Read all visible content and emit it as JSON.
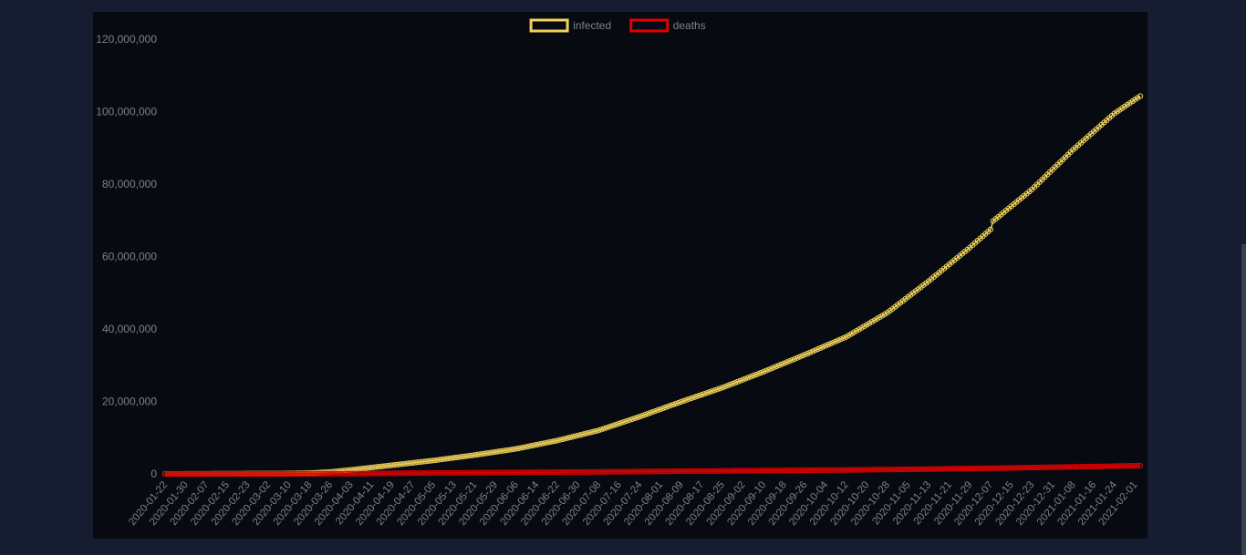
{
  "colors": {
    "page_bg": "#161d30",
    "panel_bg": "#070b11",
    "infected": "#f0d25a",
    "deaths": "#e00000",
    "tick": "#7d8088"
  },
  "legend": [
    {
      "label": "infected",
      "color": "#f0d25a"
    },
    {
      "label": "deaths",
      "color": "#e00000"
    }
  ],
  "chart_data": {
    "type": "line",
    "x_start": "2020-01-22",
    "x_end": "2021-02-03",
    "x_tick_labels": [
      "2020-01-22",
      "2020-01-30",
      "2020-02-07",
      "2020-02-15",
      "2020-02-23",
      "2020-03-02",
      "2020-03-10",
      "2020-03-18",
      "2020-03-26",
      "2020-04-03",
      "2020-04-11",
      "2020-04-19",
      "2020-04-27",
      "2020-05-05",
      "2020-05-13",
      "2020-05-21",
      "2020-05-29",
      "2020-06-06",
      "2020-06-14",
      "2020-06-22",
      "2020-06-30",
      "2020-07-08",
      "2020-07-16",
      "2020-07-24",
      "2020-08-01",
      "2020-08-09",
      "2020-08-17",
      "2020-08-25",
      "2020-09-02",
      "2020-09-10",
      "2020-09-18",
      "2020-09-26",
      "2020-10-04",
      "2020-10-12",
      "2020-10-20",
      "2020-10-28",
      "2020-11-05",
      "2020-11-13",
      "2020-11-21",
      "2020-11-29",
      "2020-12-07",
      "2020-12-15",
      "2020-12-23",
      "2020-12-31",
      "2021-01-08",
      "2021-01-16",
      "2021-01-24",
      "2021-02-01"
    ],
    "ylim": [
      0,
      120000000
    ],
    "y_tick_labels": [
      "0",
      "20,000,000",
      "40,000,000",
      "60,000,000",
      "80,000,000",
      "100,000,000",
      "120,000,000"
    ],
    "grid": false,
    "legend_position": "top",
    "series": [
      {
        "name": "infected",
        "color": "#f0d25a",
        "points": [
          [
            "2020-01-22",
            555
          ],
          [
            "2020-02-15",
            69000
          ],
          [
            "2020-03-10",
            120000
          ],
          [
            "2020-03-18",
            215000
          ],
          [
            "2020-03-26",
            530000
          ],
          [
            "2020-04-03",
            1100000
          ],
          [
            "2020-04-19",
            2400000
          ],
          [
            "2020-05-05",
            3700000
          ],
          [
            "2020-05-21",
            5200000
          ],
          [
            "2020-06-06",
            6900000
          ],
          [
            "2020-06-22",
            9200000
          ],
          [
            "2020-07-08",
            12000000
          ],
          [
            "2020-07-24",
            15800000
          ],
          [
            "2020-08-09",
            19900000
          ],
          [
            "2020-08-25",
            23800000
          ],
          [
            "2020-09-10",
            28200000
          ],
          [
            "2020-09-26",
            32900000
          ],
          [
            "2020-10-12",
            37800000
          ],
          [
            "2020-10-28",
            44500000
          ],
          [
            "2020-11-13",
            53200000
          ],
          [
            "2020-11-29",
            62500000
          ],
          [
            "2020-12-07",
            67500000
          ],
          [
            "2020-12-08",
            69800000
          ],
          [
            "2020-12-23",
            78500000
          ],
          [
            "2021-01-08",
            89500000
          ],
          [
            "2021-01-24",
            99500000
          ],
          [
            "2021-02-03",
            104300000
          ]
        ]
      },
      {
        "name": "deaths",
        "color": "#e00000",
        "points": [
          [
            "2020-01-22",
            17
          ],
          [
            "2020-03-10",
            4300
          ],
          [
            "2020-04-03",
            59000
          ],
          [
            "2020-05-05",
            255000
          ],
          [
            "2020-06-06",
            400000
          ],
          [
            "2020-07-08",
            550000
          ],
          [
            "2020-08-09",
            730000
          ],
          [
            "2020-09-10",
            910000
          ],
          [
            "2020-10-12",
            1080000
          ],
          [
            "2020-11-13",
            1320000
          ],
          [
            "2020-12-15",
            1650000
          ],
          [
            "2021-01-16",
            2030000
          ],
          [
            "2021-02-03",
            2270000
          ]
        ]
      }
    ]
  }
}
